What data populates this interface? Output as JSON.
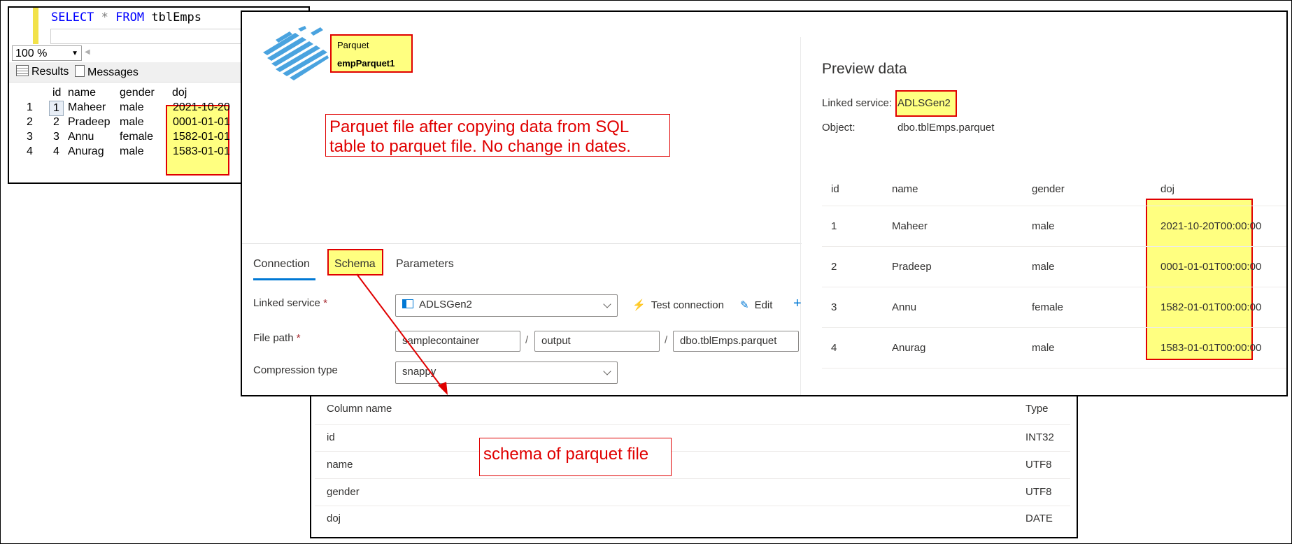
{
  "sql_editor": {
    "query_keyword1": "SELECT",
    "query_star": "*",
    "query_keyword2": "FROM",
    "query_table": "tblEmps",
    "zoom": "100 %",
    "tab_results": "Results",
    "tab_messages": "Messages",
    "columns": [
      "id",
      "name",
      "gender",
      "doj"
    ],
    "rows": [
      {
        "rownum": "1",
        "id": "1",
        "name": "Maheer",
        "gender": "male",
        "doj": "2021-10-20"
      },
      {
        "rownum": "2",
        "id": "2",
        "name": "Pradeep",
        "gender": "male",
        "doj": "0001-01-01"
      },
      {
        "rownum": "3",
        "id": "3",
        "name": "Annu",
        "gender": "female",
        "doj": "1582-01-01"
      },
      {
        "rownum": "4",
        "id": "4",
        "name": "Anurag",
        "gender": "male",
        "doj": "1583-01-01"
      }
    ]
  },
  "dataset": {
    "type": "Parquet",
    "name": "empParquet1",
    "annotation": "Parquet file after copying data from SQL table to parquet file. No change in dates.",
    "tabs": [
      "Connection",
      "Schema",
      "Parameters"
    ],
    "active_tab": "Connection",
    "linked_service_label": "Linked service",
    "linked_service_value": "ADLSGen2",
    "test_connection": "Test connection",
    "edit": "Edit",
    "file_path_label": "File path",
    "file_path": [
      "samplecontainer",
      "output",
      "dbo.tblEmps.parquet"
    ],
    "compression_label": "Compression type",
    "compression_value": "snappy",
    "required_mark": "*",
    "path_separator": "/"
  },
  "preview": {
    "title": "Preview data",
    "linked_service_label": "Linked service:",
    "linked_service_value": "ADLSGen2",
    "object_label": "Object:",
    "object_value": "dbo.tblEmps.parquet",
    "columns": [
      "id",
      "name",
      "gender",
      "doj"
    ],
    "rows": [
      {
        "id": "1",
        "name": "Maheer",
        "gender": "male",
        "doj": "2021-10-20T00:00:00"
      },
      {
        "id": "2",
        "name": "Pradeep",
        "gender": "male",
        "doj": "0001-01-01T00:00:00"
      },
      {
        "id": "3",
        "name": "Annu",
        "gender": "female",
        "doj": "1582-01-01T00:00:00"
      },
      {
        "id": "4",
        "name": "Anurag",
        "gender": "male",
        "doj": "1583-01-01T00:00:00"
      }
    ]
  },
  "schema": {
    "header_column": "Column name",
    "header_type": "Type",
    "annotation": "schema of parquet file",
    "rows": [
      {
        "name": "id",
        "type": "INT32"
      },
      {
        "name": "name",
        "type": "UTF8"
      },
      {
        "name": "gender",
        "type": "UTF8"
      },
      {
        "name": "doj",
        "type": "DATE"
      }
    ]
  },
  "colors": {
    "highlight": "#ffff80",
    "annotation_red": "#e00000",
    "accent_blue": "#0078d4",
    "sql_keyword": "#0000ff"
  }
}
